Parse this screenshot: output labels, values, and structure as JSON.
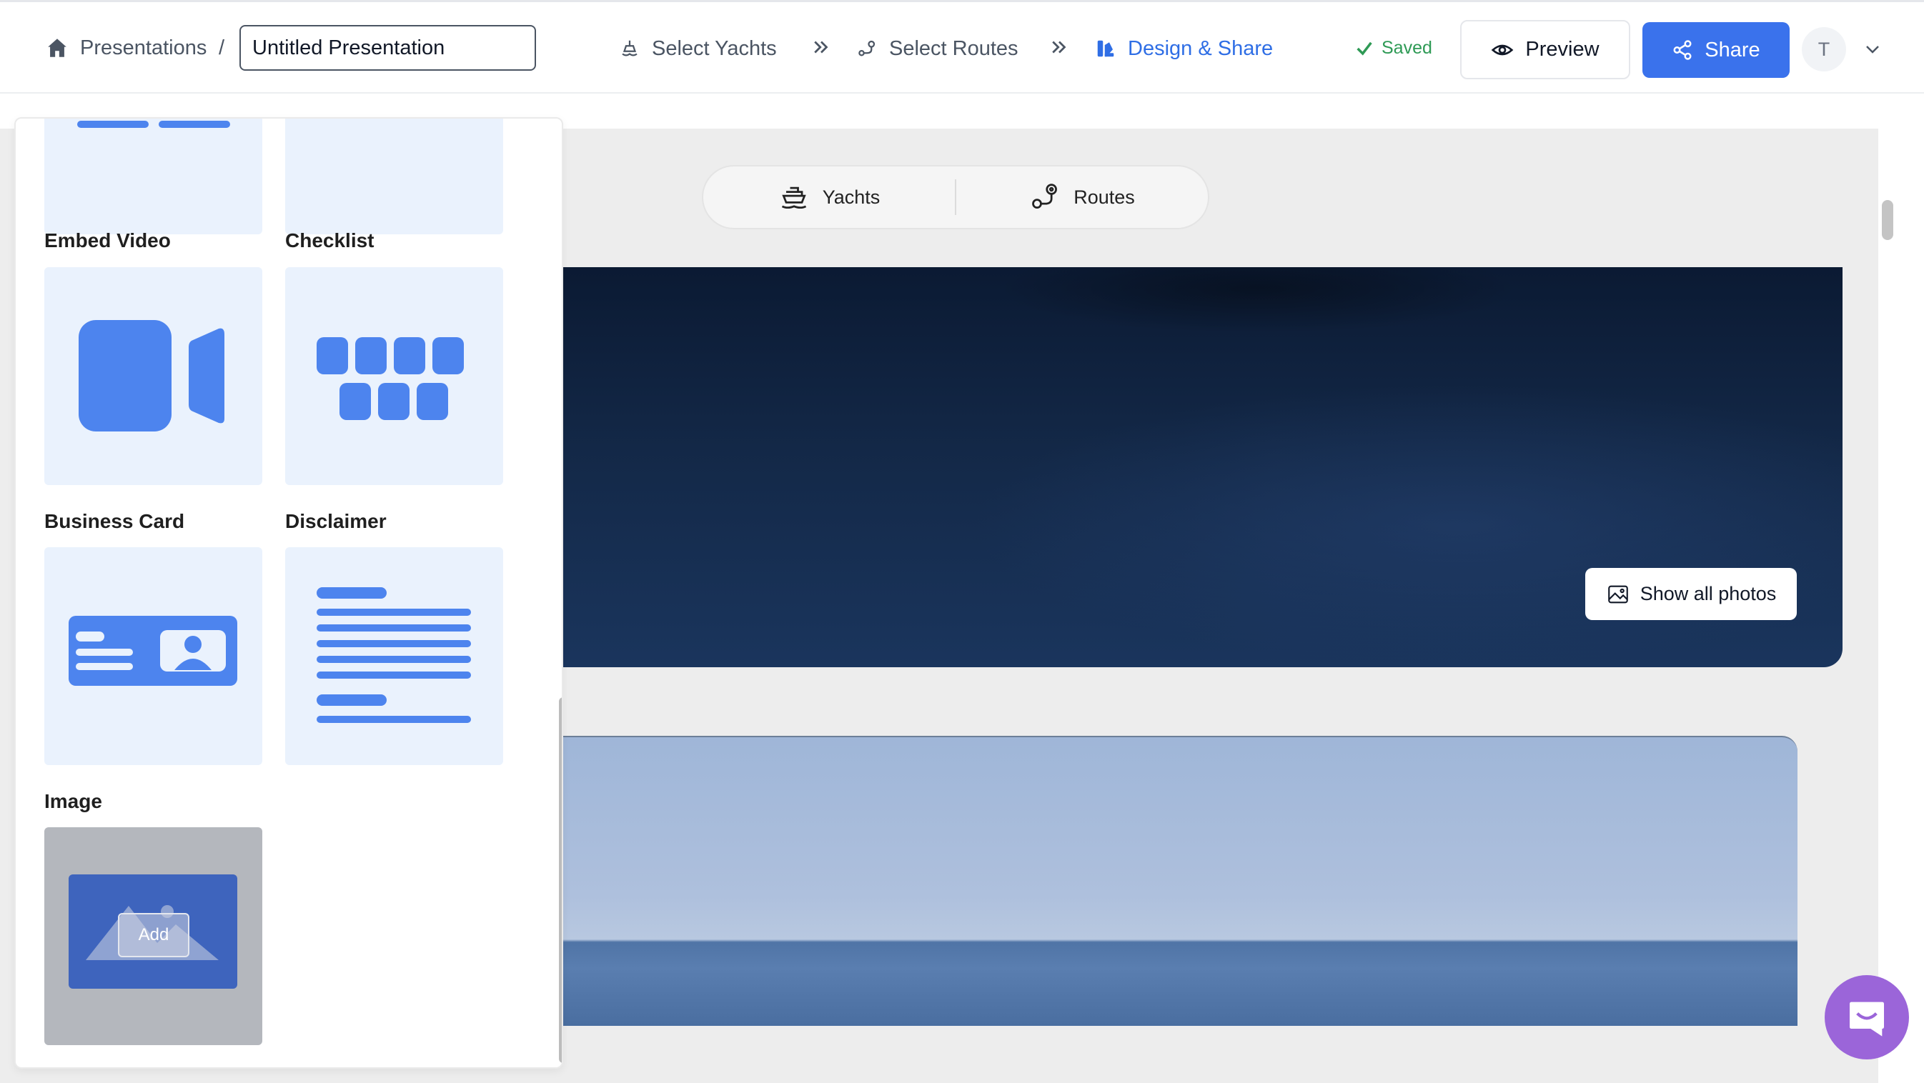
{
  "header": {
    "breadcrumb_label": "Presentations",
    "breadcrumb_separator": "/",
    "title_value": "Untitled Presentation",
    "steps": [
      {
        "label": "Select Yachts",
        "icon": "yacht-icon"
      },
      {
        "label": "Select Routes",
        "icon": "route-icon"
      },
      {
        "label": "Design & Share",
        "icon": "design-icon"
      }
    ],
    "saved_label": "Saved",
    "preview_label": "Preview",
    "share_label": "Share",
    "avatar_initial": "T"
  },
  "canvas": {
    "tabs": [
      {
        "label": "Yachts",
        "icon": "yacht-icon"
      },
      {
        "label": "Routes",
        "icon": "route-icon"
      }
    ],
    "show_photos_label": "Show all photos"
  },
  "panel": {
    "blocks": [
      {
        "label": "Embed Video",
        "icon": "video-icon"
      },
      {
        "label": "Checklist",
        "icon": "checklist-icon"
      },
      {
        "label": "Business Card",
        "icon": "business-card-icon"
      },
      {
        "label": "Disclaimer",
        "icon": "disclaimer-icon"
      },
      {
        "label": "Image",
        "icon": "image-icon",
        "overlay": "Add"
      }
    ]
  },
  "colors": {
    "accent": "#3a72ec",
    "tile_bg": "#eaf2fd",
    "icon_blue": "#4d84ee",
    "saved_green": "#2e9a55",
    "chat_purple": "#9b65d9"
  }
}
